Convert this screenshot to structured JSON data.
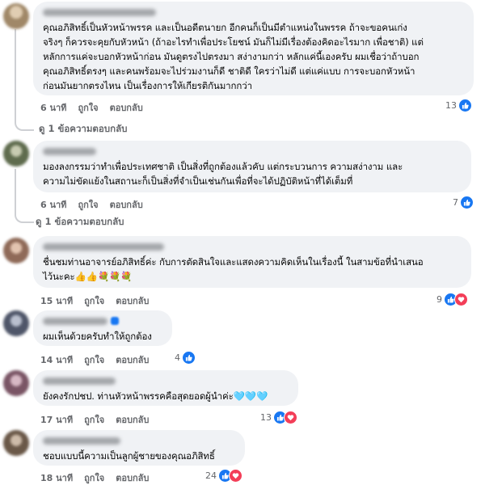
{
  "actions": {
    "like": "ถูกใจ",
    "reply": "ตอบกลับ"
  },
  "comments": [
    {
      "text": "คุณอภิสิทธิ์เป็นหัวหน้าพรรค และเป็นอดีตนายก อีกคนก็เป็นมีตำแหน่งในพรรค ถ้าจะขอคนเก่ง\nจริงๆ ก็ควรจะคุยกับหัวหน้า (ถ้าอะไรทำเพื่อประโยชน์ มันก็ไม่มีเรื่องต้องคิดอะไรมาก เพื่อชาติ) แต่\nหลักการแค่จะบอกหัวหน้าก่อน มันดูตรงไปตรงมา สง่างามกว่า หลักแค่นี้เองครับ ผมเชื่อว่าถ้าบอก\nคุณอภิสิทธิ์ตรงๆ และคนพร้อมจะไปร่วมงานก็ดี ชาติดี ใครว่าไม่ดี แต่แค่แบบ การจะบอกหัวหน้า\nก่อนมันยากตรงไหน เป็นเรื่องการให้เกียรติกันมากกว่า",
      "time": "6 นาที",
      "count": "13",
      "reactions": [
        "like"
      ],
      "replies": "ดู 1 ข้อความตอบกลับ",
      "avatar_color": "#b6a58c"
    },
    {
      "text": "มองลงกรรมว่าทำเพื่อประเทศชาติ เป็นสิ่งที่ถูกต้องแล้วคับ แต่กระบวนการ ความสง่างาม และ\nความไม่ขัดแย้งในสถานะก็เป็นสิ่งที่จำเป็นเช่นกันเพื่อที่จะได้ปฏิบัติหน้าที่ได้เต็มที่",
      "time": "6 นาที",
      "count": "7",
      "reactions": [
        "like"
      ],
      "replies": "ดู 1 ข้อความตอบกลับ",
      "avatar_color": "#7d8c6a"
    },
    {
      "text": "ชื่นชมท่านอาจารย์อภิสิทธิ์ค่ะ กับการตัดสินใจและแสดงความคิดเห็นในเรื่องนี้ ในสามข้อที่นำเสนอ\nไว้นะคะ👍👍💐💐💐",
      "time": "15 นาที",
      "count": "9",
      "reactions": [
        "like",
        "love"
      ],
      "avatar_color": "#9c7f6e"
    },
    {
      "text": "ผมเห็นด้วยครับทำให้ถูกต้อง",
      "time": "14 นาที",
      "count": "4",
      "reactions": [
        "like"
      ],
      "avatar_color": "#6d7485"
    },
    {
      "text": "ยังคงรักปชป. ท่านหัวหน้าพรรคคือสุดยอดผู้นำค่ะ🩵🩵🩵",
      "time": "17 นาที",
      "count": "13",
      "reactions": [
        "like",
        "love"
      ],
      "avatar_color": "#8e6f7c"
    },
    {
      "text": "ชอบแบบนี้ความเป็นลูกผู้ชายของคุณอภิสิทธิ์",
      "time": "18 นาที",
      "count": "24",
      "reactions": [
        "like",
        "love"
      ],
      "avatar_color": "#7a6a5c"
    }
  ]
}
